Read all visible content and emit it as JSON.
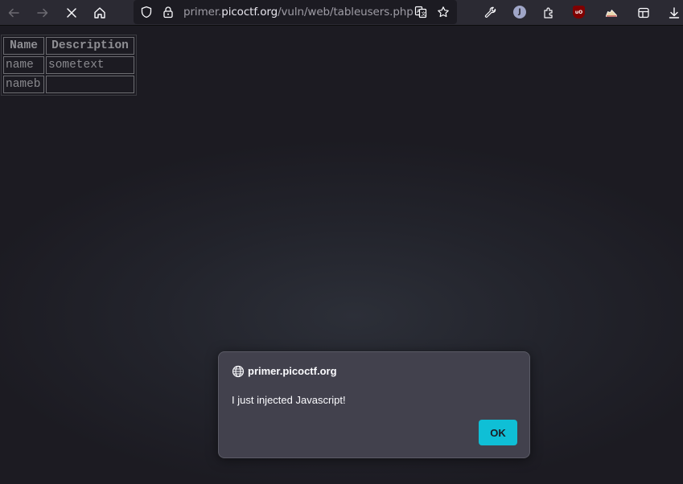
{
  "browser": {
    "url_prefix": "primer.",
    "url_domain": "picoctf.org",
    "url_path": "/vuln/web/tableusers.php",
    "avatar_letter": "J",
    "ublock_label": "uO",
    "icons": [
      "back-icon",
      "forward-icon",
      "stop-icon",
      "home-icon",
      "shield-icon",
      "lock-icon",
      "translate-icon",
      "star-icon",
      "wrench-icon",
      "account-icon",
      "extensions-icon",
      "ublock-icon",
      "sneaker-extension-icon",
      "reader-icon",
      "download-icon"
    ]
  },
  "table": {
    "headers": [
      "Name",
      "Description"
    ],
    "rows": [
      {
        "name": "name",
        "description": "sometext"
      },
      {
        "name": "nameb",
        "description": ""
      }
    ]
  },
  "dialog": {
    "origin": "primer.picoctf.org",
    "message": "I just injected Javascript!",
    "ok_label": "OK"
  },
  "colors": {
    "toolbar": "#2b2a33",
    "page_bg": "#1c1b22",
    "dialog_bg": "#42414d",
    "accent": "#0fbfd6"
  }
}
